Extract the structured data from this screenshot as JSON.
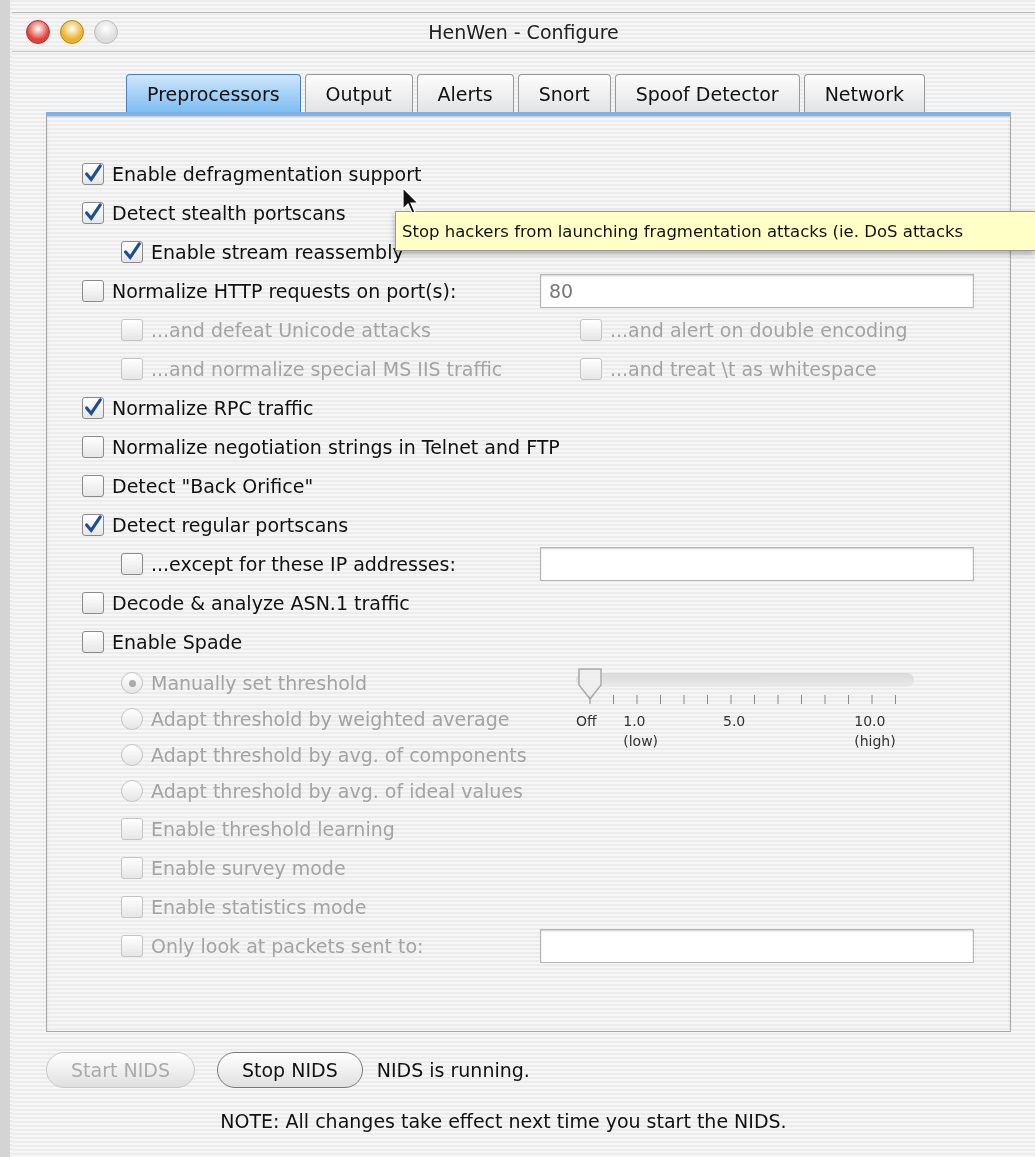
{
  "window": {
    "title": "HenWen - Configure"
  },
  "tabs": [
    {
      "label": "Preprocessors",
      "selected": true
    },
    {
      "label": "Output",
      "selected": false
    },
    {
      "label": "Alerts",
      "selected": false
    },
    {
      "label": "Snort",
      "selected": false
    },
    {
      "label": "Spoof Detector",
      "selected": false
    },
    {
      "label": "Network",
      "selected": false
    }
  ],
  "options": [
    {
      "kind": "check",
      "label": "Enable defragmentation support",
      "checked": true,
      "disabled": false
    },
    {
      "kind": "check",
      "label": "Detect stealth portscans",
      "checked": true,
      "disabled": false,
      "children": [
        {
          "kind": "check",
          "label": "Enable stream reassembly",
          "checked": true,
          "disabled": false
        }
      ]
    },
    {
      "kind": "check_field",
      "label": "Normalize HTTP requests on port(s):",
      "checked": false,
      "disabled": false,
      "value": "80",
      "children": [
        {
          "kind": "pair",
          "items": [
            {
              "kind": "check",
              "label": "...and defeat Unicode attacks",
              "checked": false,
              "disabled": true
            },
            {
              "kind": "check",
              "label": "...and alert on double encoding",
              "checked": false,
              "disabled": true
            }
          ]
        },
        {
          "kind": "pair",
          "items": [
            {
              "kind": "check",
              "label": "...and normalize special MS IIS traffic",
              "checked": false,
              "disabled": true
            },
            {
              "kind": "check",
              "label": "...and treat \\t as whitespace",
              "checked": false,
              "disabled": true
            }
          ]
        }
      ]
    },
    {
      "kind": "check",
      "label": "Normalize RPC traffic",
      "checked": true,
      "disabled": false
    },
    {
      "kind": "check",
      "label": "Normalize negotiation strings in Telnet and FTP",
      "checked": false,
      "disabled": false
    },
    {
      "kind": "check",
      "label": "Detect \"Back Orifice\"",
      "checked": false,
      "disabled": false
    },
    {
      "kind": "check",
      "label": "Detect regular portscans",
      "checked": true,
      "disabled": false,
      "children": [
        {
          "kind": "check_field",
          "label": "...except for these IP addresses:",
          "checked": false,
          "disabled": false
        }
      ]
    },
    {
      "kind": "check",
      "label": "Decode & analyze ASN.1 traffic",
      "checked": false,
      "disabled": false
    },
    {
      "kind": "spade",
      "label": "Enable Spade",
      "checked": false,
      "disabled": false,
      "modes": [
        {
          "label": "Manually set threshold",
          "selected": true,
          "disabled": true
        },
        {
          "label": "Adapt threshold by weighted average",
          "selected": false,
          "disabled": true
        },
        {
          "label": "Adapt threshold by avg. of components",
          "selected": false,
          "disabled": true
        },
        {
          "label": "Adapt threshold by avg. of ideal values",
          "selected": false,
          "disabled": true
        }
      ],
      "slider": {
        "level": 0,
        "disabled": true,
        "ticks": [
          {
            "label": "Off"
          },
          {
            "label": "1.0",
            "note": "(low)"
          },
          {
            "label": "5.0"
          },
          {
            "label": "10.0",
            "note": "(high)"
          }
        ]
      },
      "children": [
        {
          "kind": "check",
          "label": "Enable threshold learning",
          "checked": false,
          "disabled": true
        },
        {
          "kind": "check",
          "label": "Enable survey mode",
          "checked": false,
          "disabled": true
        },
        {
          "kind": "check",
          "label": "Enable statistics mode",
          "checked": false,
          "disabled": true
        },
        {
          "kind": "check_field",
          "label": "Only look at packets sent to:",
          "checked": false,
          "disabled": true
        }
      ]
    }
  ],
  "tooltip": {
    "text": "Stop hackers from launching fragmentation attacks (ie. DoS attacks"
  },
  "buttons": [
    {
      "label": "Start NIDS",
      "disabled": true
    },
    {
      "label": "Stop NIDS",
      "disabled": false
    }
  ],
  "status": "NIDS is running.",
  "note": "NOTE: All changes take effect next time you start the NIDS."
}
